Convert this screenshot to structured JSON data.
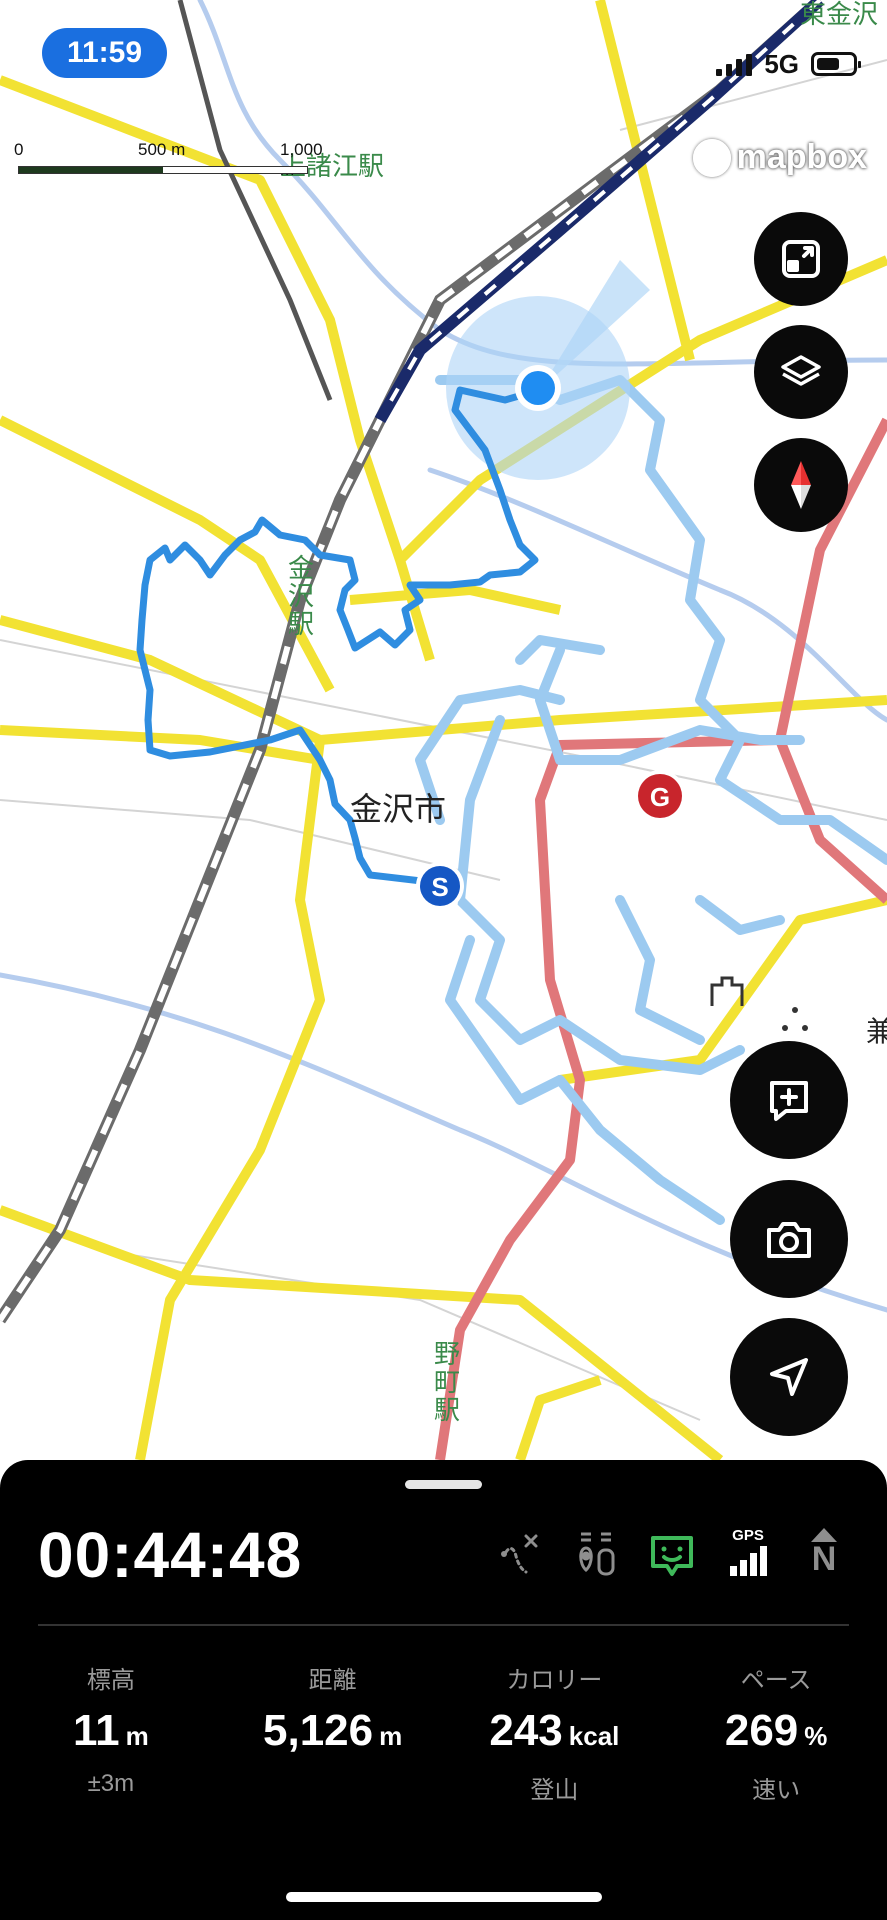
{
  "status_bar": {
    "time": "11:59",
    "network": "5G"
  },
  "map": {
    "scale": {
      "zero": "0",
      "mid": "500 m",
      "end": "1,000 m"
    },
    "attribution": "mapbox",
    "labels": {
      "city": "金沢市",
      "station_kanazawa": "金\n沢\n駅",
      "station_nomachi": "野\n町\n駅",
      "station_top": "上諸江駅",
      "edge_top": "東金沢",
      "edge_right": "兼"
    },
    "markers": {
      "start": "S",
      "goal": "G"
    }
  },
  "buttons": {
    "expand": "expand-icon",
    "layers": "layers-icon",
    "compass": "compass-icon",
    "add_note": "add-note-icon",
    "camera": "camera-icon",
    "locate": "navigation-arrow-icon"
  },
  "panel": {
    "timer": "00:44:48",
    "status_icons": [
      "route-off-icon",
      "hiker-icon",
      "face-icon",
      "gps-signal-icon",
      "north-icon"
    ],
    "gps_label": "GPS",
    "north_label": "N",
    "stats": [
      {
        "label": "標高",
        "value": "11",
        "unit": "m",
        "sub": "±3m"
      },
      {
        "label": "距離",
        "value": "5,126",
        "unit": "m",
        "sub": ""
      },
      {
        "label": "カロリー",
        "value": "243",
        "unit": "kcal",
        "sub": "登山"
      },
      {
        "label": "ペース",
        "value": "269",
        "unit": "%",
        "sub": "速い"
      }
    ]
  },
  "colors": {
    "route": "#2f8de0",
    "track": "#9ccaf0",
    "road_major": "#f2e233",
    "road_red": "#e0777a",
    "location": "#1f8df2"
  }
}
